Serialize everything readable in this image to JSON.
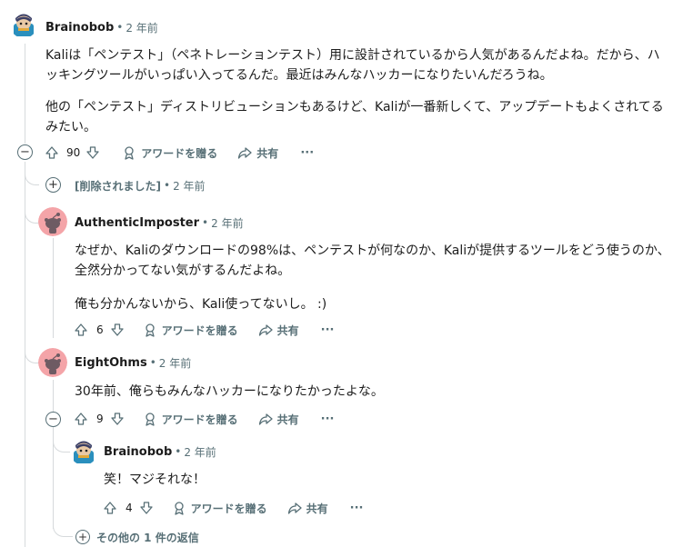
{
  "comments": [
    {
      "username": "Brainobob",
      "age": "2 年前",
      "paragraphs": [
        "Kaliは「ペンテスト」（ペネトレーションテスト）用に設計されているから人気があるんだよね。だから、ハッキングツールがいっぱい入ってるんだ。最近はみんなハッカーになりたいんだろうね。",
        "他の「ペンテスト」ディストリビューションもあるけど、Kaliが一番新しくて、アップデートもよくされてるみたい。"
      ],
      "votes": "90",
      "award_label": "アワードを贈る",
      "share_label": "共有",
      "more_label": "···"
    },
    {
      "deleted_label": "[削除されました]",
      "age": "2 年前"
    },
    {
      "username": "AuthenticImposter",
      "age": "2 年前",
      "paragraphs": [
        "なぜか、Kaliのダウンロードの98%は、ペンテストが何なのか、Kaliが提供するツールをどう使うのか、全然分かってない気がするんだよね。",
        "俺も分かんないから、Kali使ってないし。 :)"
      ],
      "votes": "6",
      "award_label": "アワードを贈る",
      "share_label": "共有",
      "more_label": "···"
    },
    {
      "username": "EightOhms",
      "age": "2 年前",
      "paragraphs": [
        "30年前、俺らもみんなハッカーになりたかったよな。"
      ],
      "votes": "9",
      "award_label": "アワードを贈る",
      "share_label": "共有",
      "more_label": "···"
    },
    {
      "username": "Brainobob",
      "age": "2 年前",
      "paragraphs": [
        "笑！マジそれな！"
      ],
      "votes": "4",
      "award_label": "アワードを贈る",
      "share_label": "共有",
      "more_label": "···"
    }
  ],
  "more_replies_label": "その他の 1 件の返信",
  "icons": {
    "upvote": "arrow-up-icon",
    "downvote": "arrow-down-icon",
    "award": "award-icon",
    "share": "share-icon",
    "collapse": "minus-circle-icon",
    "expand": "plus-circle-icon"
  },
  "colors": {
    "text": "#1c1c1c",
    "muted": "#576f76",
    "thread_line": "#d6dadc",
    "snoo_bg": "#f4a4a8"
  }
}
